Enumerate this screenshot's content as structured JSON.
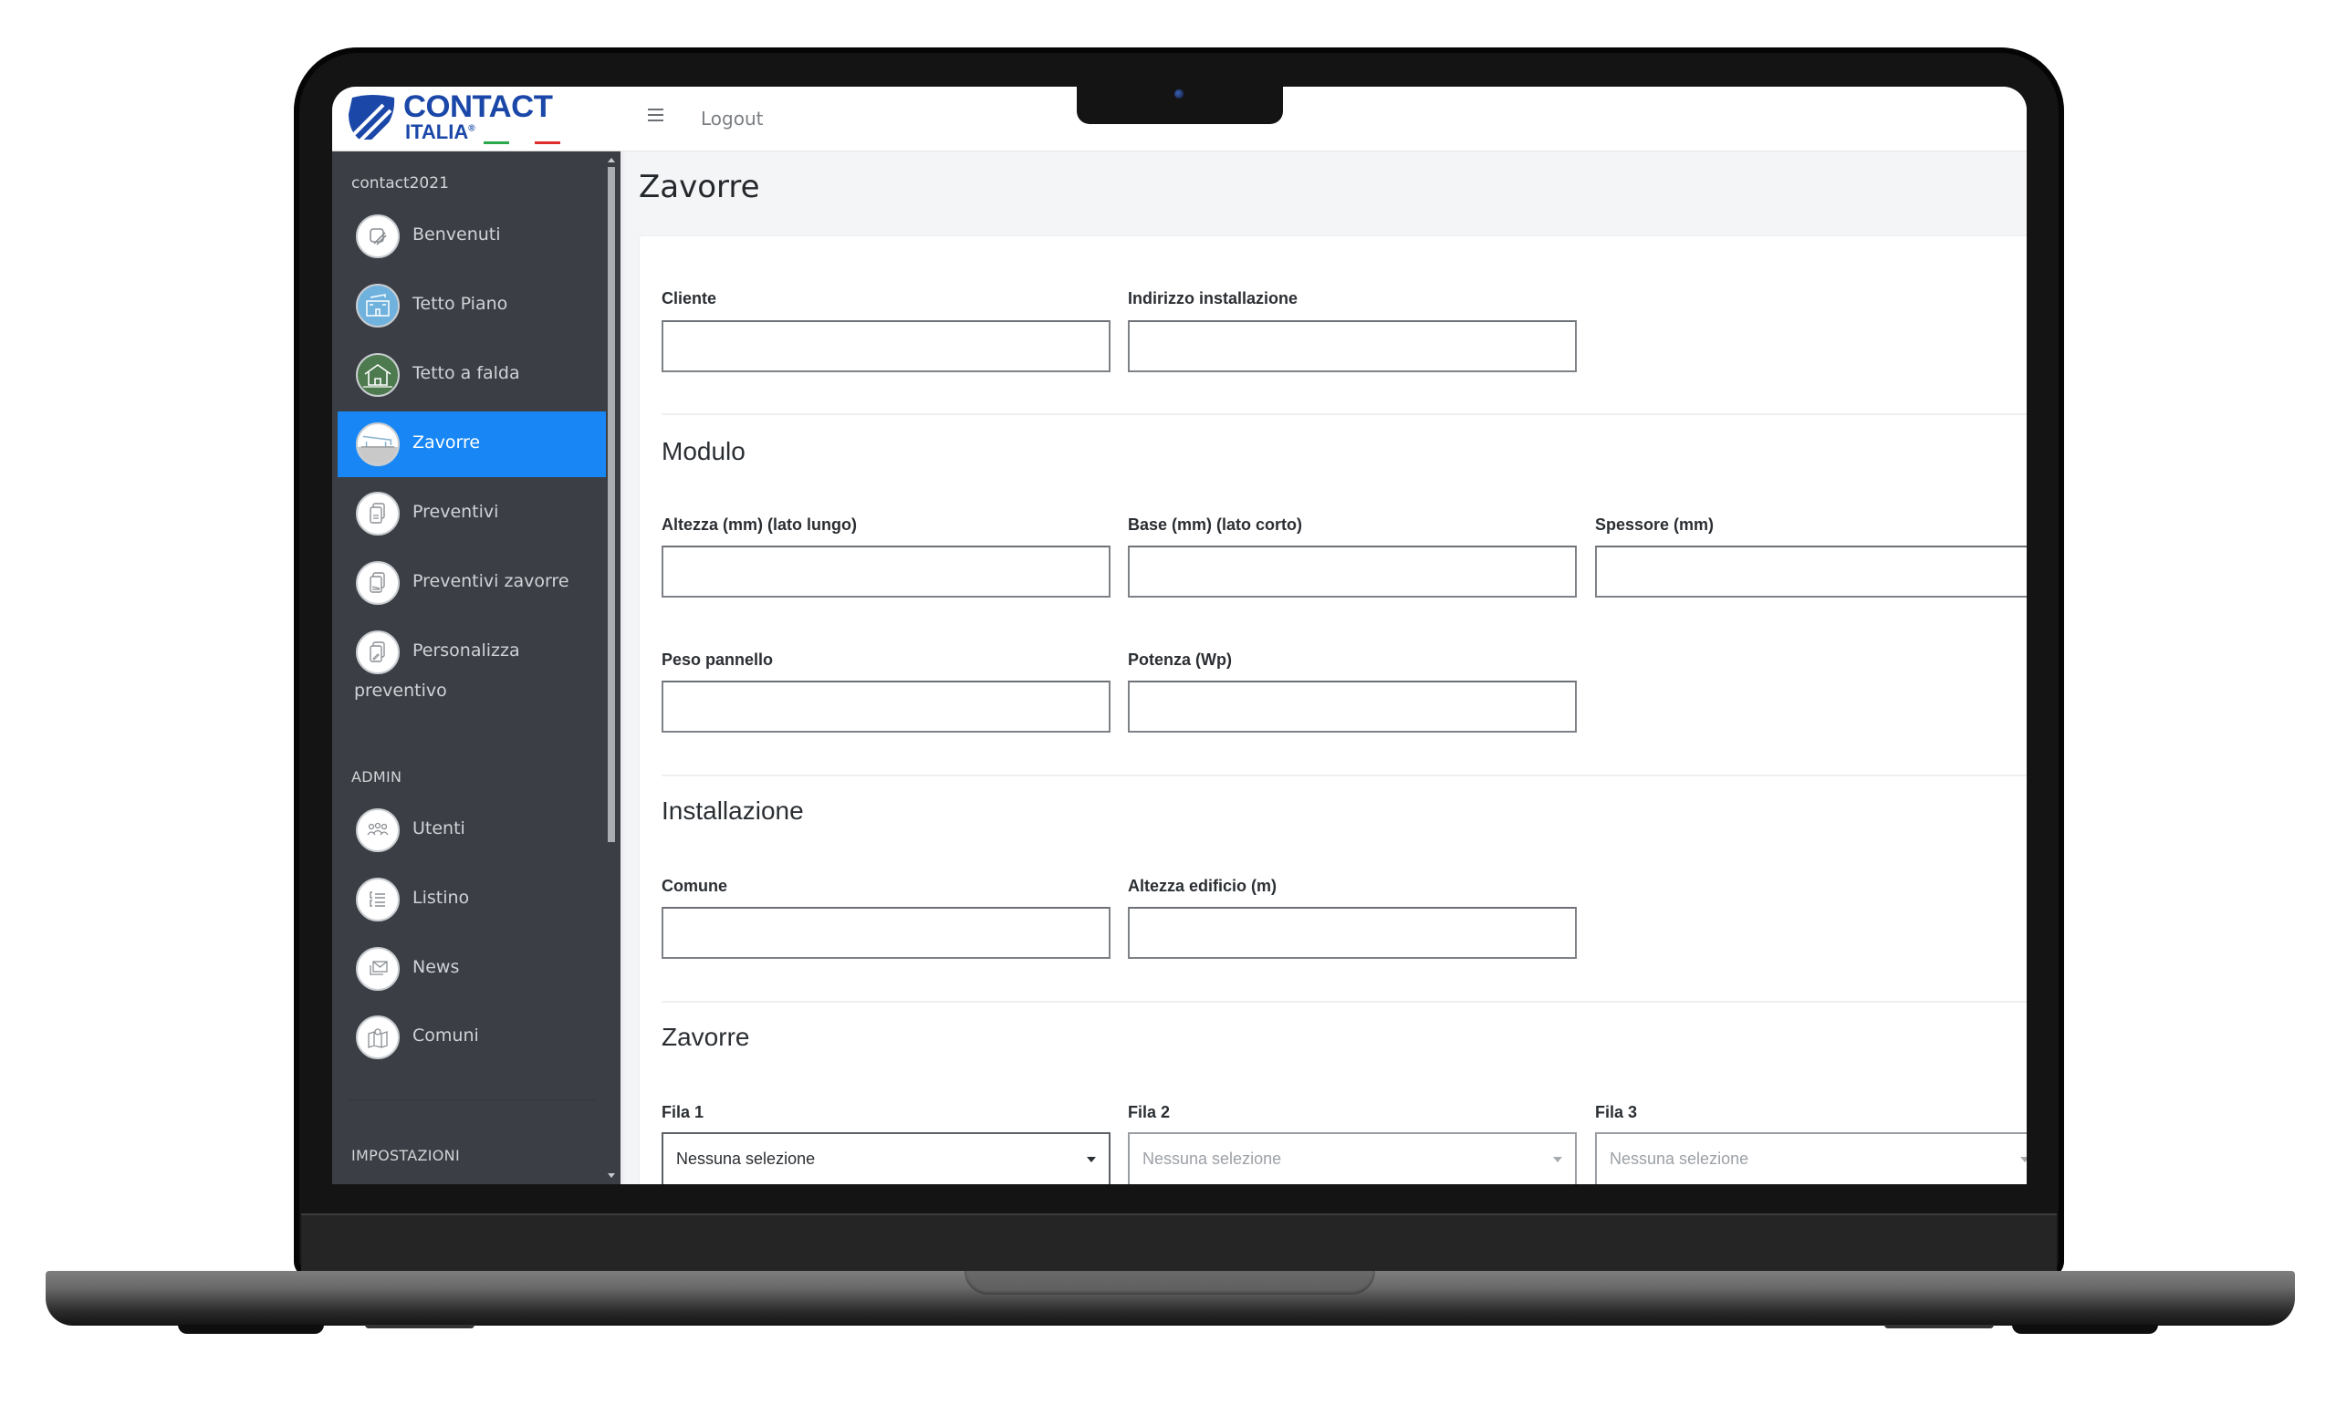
{
  "brand": {
    "name": "CONTACT",
    "sub": "ITALIA",
    "registered": "®",
    "primary_color": "#1a47a8",
    "flag_green": "#2aa84a",
    "flag_red": "#e02b2b"
  },
  "topbar": {
    "menu_icon": "hamburger-icon",
    "logout_label": "Logout"
  },
  "sidebar": {
    "user": "contact2021",
    "active_color": "#1887f5",
    "items": [
      {
        "label": "Benvenuti",
        "icon": "welcome-icon"
      },
      {
        "label": "Tetto Piano",
        "icon": "flat-roof-icon"
      },
      {
        "label": "Tetto a falda",
        "icon": "pitched-roof-icon"
      },
      {
        "label": "Zavorre",
        "icon": "ballast-icon",
        "active": true
      },
      {
        "label": "Preventivi",
        "icon": "quotes-icon"
      },
      {
        "label": "Preventivi zavorre",
        "icon": "ballast-quotes-icon"
      },
      {
        "label": "Personalizza",
        "label_line2": "preventivo",
        "icon": "customize-quote-icon"
      }
    ],
    "admin_section": "ADMIN",
    "admin_items": [
      {
        "label": "Utenti",
        "icon": "users-icon"
      },
      {
        "label": "Listino",
        "icon": "price-list-icon"
      },
      {
        "label": "News",
        "icon": "news-icon"
      },
      {
        "label": "Comuni",
        "icon": "map-icon"
      }
    ],
    "settings_section": "IMPOSTAZIONI"
  },
  "page": {
    "title": "Zavorre"
  },
  "form": {
    "general": {
      "cliente": {
        "label": "Cliente",
        "value": ""
      },
      "indirizzo": {
        "label": "Indirizzo installazione",
        "value": ""
      }
    },
    "modulo": {
      "title": "Modulo",
      "altezza": {
        "label": "Altezza (mm) (lato lungo)",
        "value": ""
      },
      "base": {
        "label": "Base (mm) (lato corto)",
        "value": ""
      },
      "spessore": {
        "label": "Spessore (mm)",
        "value": ""
      },
      "peso": {
        "label": "Peso pannello",
        "value": ""
      },
      "potenza": {
        "label": "Potenza (Wp)",
        "value": ""
      }
    },
    "installazione": {
      "title": "Installazione",
      "comune": {
        "label": "Comune",
        "value": ""
      },
      "altezza_edificio": {
        "label": "Altezza edificio (m)",
        "value": ""
      }
    },
    "zavorre": {
      "title": "Zavorre",
      "fila1": {
        "label": "Fila 1",
        "selected": "Nessuna selezione",
        "enabled": true
      },
      "fila2": {
        "label": "Fila 2",
        "selected": "Nessuna selezione",
        "enabled": false
      },
      "fila3": {
        "label": "Fila 3",
        "selected": "Nessuna selezione",
        "enabled": false
      }
    }
  }
}
